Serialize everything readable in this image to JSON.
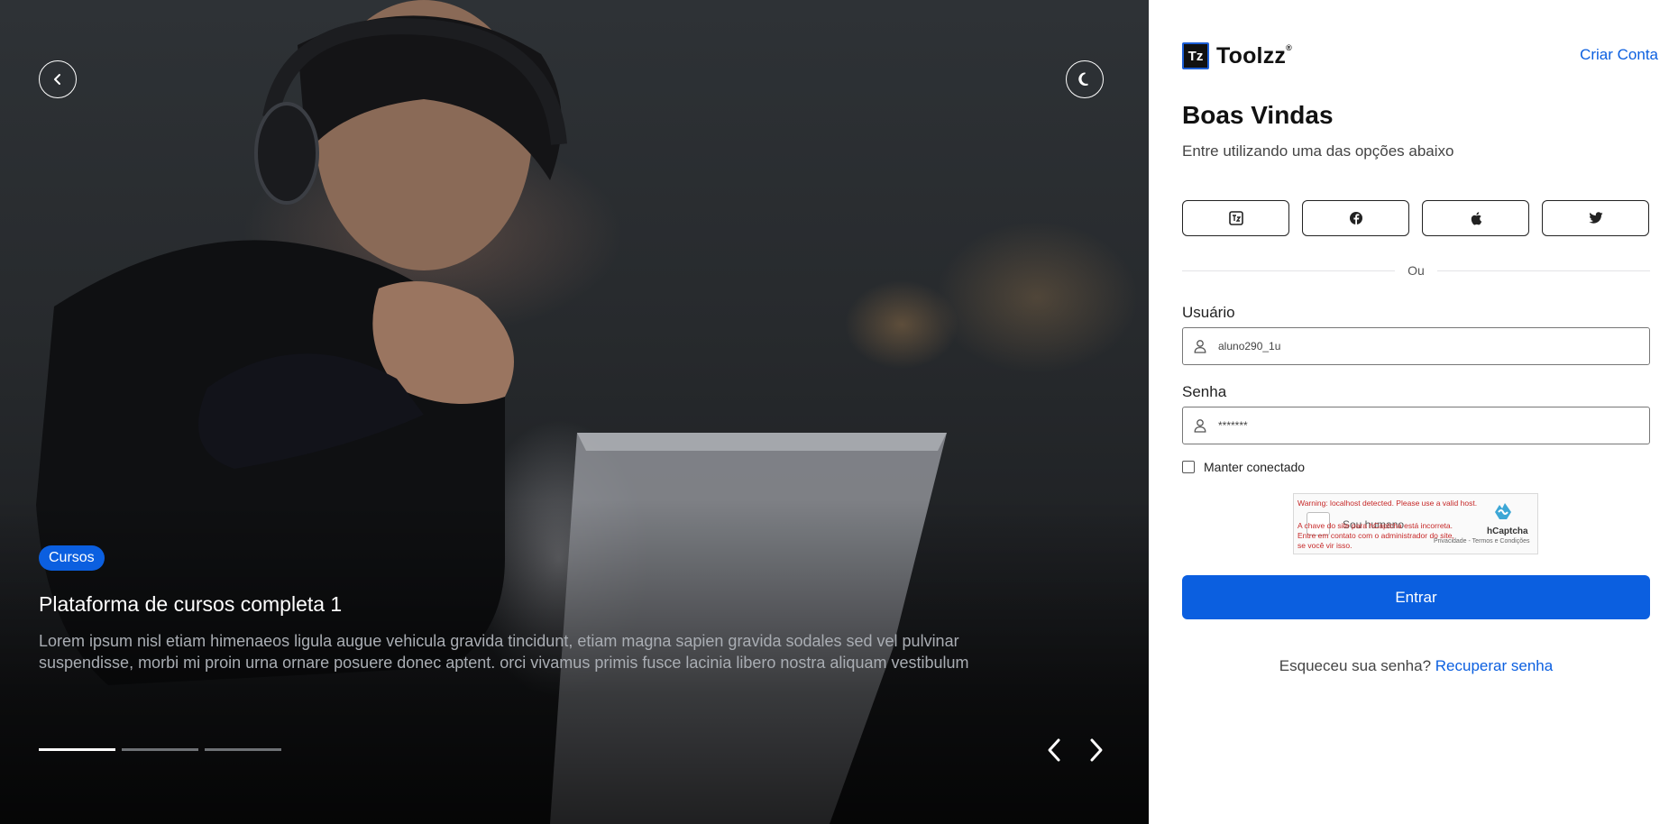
{
  "brand": {
    "name": "Toolzz",
    "reg_mark": "®",
    "mark_letters": "Tz"
  },
  "hero": {
    "badge": "Cursos",
    "title": "Plataforma de cursos completa 1",
    "description": "Lorem ipsum nisl etiam himenaeos ligula augue vehicula gravida tincidunt, etiam magna sapien gravida sodales sed vel pulvinar suspendisse, morbi mi proin urna ornare posuere donec aptent. orci vivamus primis fusce lacinia libero nostra aliquam vestibulum",
    "active_slide": 1,
    "slide_count": 3
  },
  "header": {
    "create_account": "Criar Conta"
  },
  "login": {
    "heading": "Boas Vindas",
    "subtitle": "Entre utilizando uma das opções abaixo",
    "social_providers": [
      "toolzz-icon",
      "facebook-icon",
      "apple-icon",
      "twitter-icon"
    ],
    "divider": "Ou",
    "username_label": "Usuário",
    "username_value": "aluno290_1u",
    "password_label": "Senha",
    "password_value": "*******",
    "remember_label": "Manter conectado",
    "submit_label": "Entrar",
    "forgot_text": "Esqueceu sua senha?",
    "forgot_link": "Recuperar senha"
  },
  "captcha": {
    "warning": "Warning: localhost detected. Please use a valid host.",
    "checkbox_label": "Sou humano",
    "error": "A chave do site para hCaptcha está incorreta. Entre em contato com o administrador do site, se você vir isso.",
    "brand": "hCaptcha",
    "terms": "Privacidade - Termos e Condições"
  },
  "colors": {
    "accent": "#0b5fe0",
    "text": "#111111"
  }
}
